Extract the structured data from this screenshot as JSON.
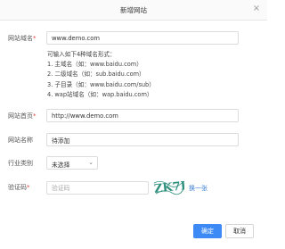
{
  "dialog": {
    "title": "新增网站",
    "close_icon": "close-icon"
  },
  "form": {
    "domain": {
      "label": "网站域名",
      "required": true,
      "value": "www.demo.com"
    },
    "hint": {
      "intro": "可输入如下4种域名形式：",
      "lines": [
        "1. 主域名（如：www.baidu.com）",
        "2. 二级域名（如：sub.baidu.com）",
        "3. 子目录（如：www.baidu.com/sub）",
        "4. wap站域名（如：wap.baidu.com）"
      ]
    },
    "homepage": {
      "label": "网站首页",
      "required": true,
      "value": "http://www.demo.com"
    },
    "site_name": {
      "label": "网站名称",
      "required": false,
      "value": "待添加"
    },
    "industry": {
      "label": "行业类别",
      "required": false,
      "selected": "未选择"
    },
    "captcha": {
      "label": "验证码",
      "required": true,
      "placeholder": "验证码",
      "image_text": "ZK7F",
      "refresh_label": "换一张"
    }
  },
  "buttons": {
    "confirm_label": "确定",
    "cancel_label": "取消"
  },
  "colors": {
    "primary": "#3d8af7",
    "required": "#e64340",
    "link": "#3b7fd6"
  }
}
